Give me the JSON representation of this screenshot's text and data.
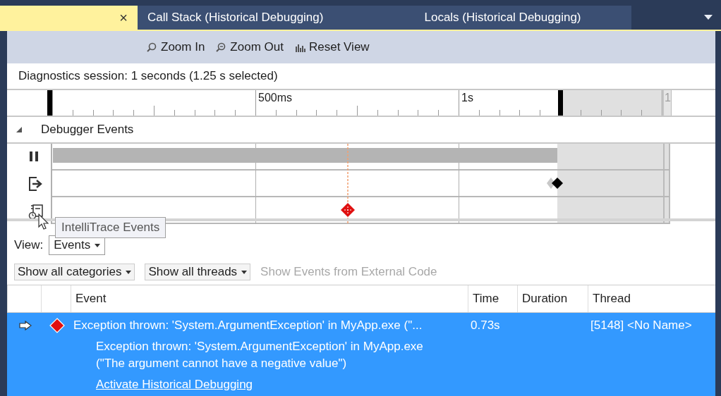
{
  "tabs": [
    {
      "close": "×",
      "selected": true
    },
    {
      "label": "Call Stack (Historical Debugging)",
      "selected": false
    },
    {
      "label": "Locals (Historical Debugging)",
      "selected": false
    }
  ],
  "toolbar": {
    "buttons": [
      {
        "label": "Zoom In",
        "kind": "zoom-in"
      },
      {
        "label": "Zoom Out",
        "kind": "zoom-out"
      },
      {
        "label": "Reset View",
        "kind": "reset"
      }
    ]
  },
  "session_summary": "Diagnostics session: 1 seconds (1.25 s selected)",
  "ruler": {
    "labels": [
      "500ms",
      "1s",
      "1"
    ]
  },
  "track_group": {
    "label": "Debugger Events",
    "expanded": true
  },
  "tooltip": "IntelliTrace Events",
  "view": {
    "label": "View:",
    "value": "Events"
  },
  "filters": [
    {
      "label": "Show all categories",
      "kind": "dropdown",
      "disabled": false
    },
    {
      "label": "Show all threads",
      "kind": "dropdown",
      "disabled": false
    },
    {
      "label": "Show Events from External Code",
      "kind": "toggle",
      "disabled": true
    }
  ],
  "table": {
    "columns": [
      "Event",
      "Time",
      "Duration",
      "Thread"
    ],
    "rows": [
      {
        "event": "Exception thrown: 'System.ArgumentException' in MyApp.exe (\"...",
        "time": "0.73s",
        "thread": "[5148] <No Name>",
        "selected": true,
        "current": true,
        "expanded": true,
        "details": [
          "Exception thrown: 'System.ArgumentException' in MyApp.exe",
          "(\"The argument cannot have a negative value\")"
        ],
        "link": "Activate Historical Debugging"
      }
    ]
  }
}
